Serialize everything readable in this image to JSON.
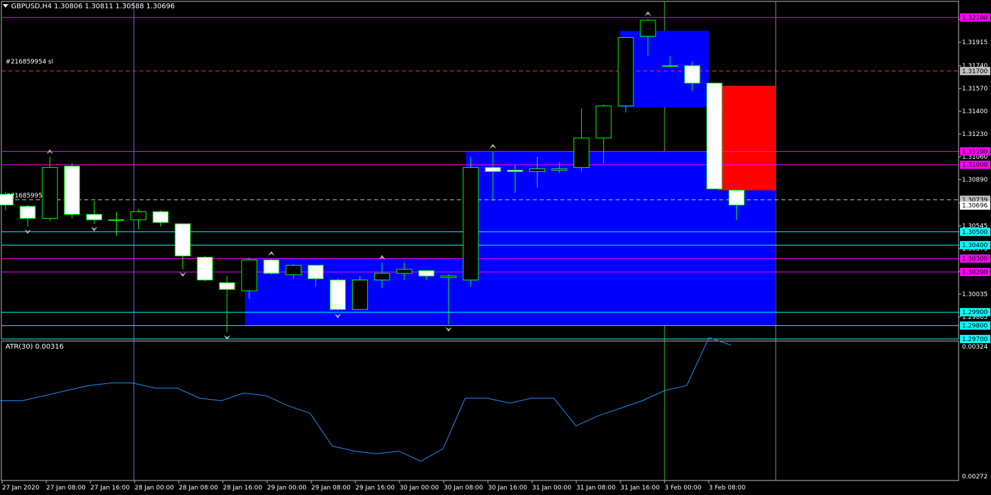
{
  "header": {
    "title": "GBPUSD,H4  1.30806 1.30811 1.30588 1.30696"
  },
  "indicator": {
    "label": "ATR(30) 0.00316"
  },
  "labels": {
    "stop_loss": "#216859954 sl",
    "order": "#21685995"
  },
  "colors": {
    "background": "#000000",
    "candle_up": "#000000",
    "candle_down": "#ffffff",
    "wick": "#00ff00",
    "zone_blue": "#0000ff",
    "zone_red": "#ff0000",
    "level_magenta": "#ff00ff",
    "level_cyan": "#00ffff",
    "atr_line": "#1e90ff",
    "grid_time": "#7b68ee",
    "grid_time2": "#32cd32"
  },
  "price_axis": {
    "ticks": [
      "1.32085",
      "1.31915",
      "1.31740",
      "1.31570",
      "1.31400",
      "1.31230",
      "1.31060",
      "1.30890",
      "1.30715",
      "1.30545",
      "1.30375",
      "1.30205",
      "1.30035",
      "1.29865"
    ],
    "ylim": [
      1.297,
      1.3222
    ]
  },
  "price_labels": [
    {
      "text": "1.32100",
      "price": 1.321,
      "color": "#ff00ff"
    },
    {
      "text": "1.31700",
      "price": 1.317,
      "color": "#c0c0c0"
    },
    {
      "text": "1.31100",
      "price": 1.311,
      "color": "#ff00ff"
    },
    {
      "text": "1.31000",
      "price": 1.31,
      "color": "#ff00ff"
    },
    {
      "text": "1.30739",
      "price": 1.30739,
      "color": "#c0c0c0"
    },
    {
      "text": "1.30696",
      "price": 1.30696,
      "color": "#ffffff"
    },
    {
      "text": "1.30500",
      "price": 1.305,
      "color": "#00ffff"
    },
    {
      "text": "1.30400",
      "price": 1.304,
      "color": "#00ffff"
    },
    {
      "text": "1.30300",
      "price": 1.303,
      "color": "#ff00ff"
    },
    {
      "text": "1.30200",
      "price": 1.302,
      "color": "#ff00ff"
    },
    {
      "text": "1.29900",
      "price": 1.299,
      "color": "#00ffff"
    },
    {
      "text": "1.29800",
      "price": 1.298,
      "color": "#00ffff"
    },
    {
      "text": "1.29700",
      "price": 1.297,
      "color": "#00ffff"
    }
  ],
  "atr_axis": {
    "ticks": [
      "0.00324",
      "0.00272"
    ],
    "ylim": [
      0.00272,
      0.00324
    ]
  },
  "time_axis": [
    "27 Jan 2020",
    "27 Jan 08:00",
    "27 Jan 16:00",
    "28 Jan 00:00",
    "28 Jan 08:00",
    "28 Jan 16:00",
    "29 Jan 00:00",
    "29 Jan 08:00",
    "29 Jan 16:00",
    "30 Jan 00:00",
    "30 Jan 08:00",
    "30 Jan 16:00",
    "31 Jan 00:00",
    "31 Jan 08:00",
    "31 Jan 16:00",
    "3 Feb 00:00",
    "3 Feb 08:00"
  ],
  "chart_data": {
    "type": "candlestick",
    "symbol": "GBPUSD",
    "timeframe": "H4",
    "candles": [
      {
        "o": 1.3078,
        "h": 1.308,
        "l": 1.3066,
        "c": 1.307
      },
      {
        "o": 1.3069,
        "h": 1.307,
        "l": 1.3054,
        "c": 1.306
      },
      {
        "o": 1.306,
        "h": 1.3106,
        "l": 1.3058,
        "c": 1.3098
      },
      {
        "o": 1.3099,
        "h": 1.3101,
        "l": 1.306,
        "c": 1.3063
      },
      {
        "o": 1.3063,
        "h": 1.3073,
        "l": 1.3056,
        "c": 1.3059
      },
      {
        "o": 1.3059,
        "h": 1.3065,
        "l": 1.3047,
        "c": 1.3059
      },
      {
        "o": 1.3059,
        "h": 1.3067,
        "l": 1.3052,
        "c": 1.3065
      },
      {
        "o": 1.3065,
        "h": 1.3066,
        "l": 1.3054,
        "c": 1.3057
      },
      {
        "o": 1.3056,
        "h": 1.3056,
        "l": 1.3022,
        "c": 1.3032
      },
      {
        "o": 1.3031,
        "h": 1.3032,
        "l": 1.3013,
        "c": 1.3014
      },
      {
        "o": 1.3012,
        "h": 1.3017,
        "l": 1.2975,
        "c": 1.3007
      },
      {
        "o": 1.3006,
        "h": 1.3031,
        "l": 1.3,
        "c": 1.3029
      },
      {
        "o": 1.3029,
        "h": 1.303,
        "l": 1.3018,
        "c": 1.3019
      },
      {
        "o": 1.3018,
        "h": 1.3026,
        "l": 1.3015,
        "c": 1.3025
      },
      {
        "o": 1.3025,
        "h": 1.3025,
        "l": 1.3009,
        "c": 1.3015
      },
      {
        "o": 1.3014,
        "h": 1.3015,
        "l": 1.2991,
        "c": 1.2992
      },
      {
        "o": 1.2992,
        "h": 1.3017,
        "l": 1.2992,
        "c": 1.3014
      },
      {
        "o": 1.3014,
        "h": 1.3027,
        "l": 1.3008,
        "c": 1.3019
      },
      {
        "o": 1.3019,
        "h": 1.3027,
        "l": 1.3014,
        "c": 1.3022
      },
      {
        "o": 1.3021,
        "h": 1.3021,
        "l": 1.3014,
        "c": 1.3017
      },
      {
        "o": 1.3016,
        "h": 1.3018,
        "l": 1.2981,
        "c": 1.3017
      },
      {
        "o": 1.3014,
        "h": 1.3106,
        "l": 1.3009,
        "c": 1.3098
      },
      {
        "o": 1.3098,
        "h": 1.311,
        "l": 1.3073,
        "c": 1.3095
      },
      {
        "o": 1.3096,
        "h": 1.31,
        "l": 1.3079,
        "c": 1.3095
      },
      {
        "o": 1.3095,
        "h": 1.3106,
        "l": 1.3083,
        "c": 1.3097
      },
      {
        "o": 1.3096,
        "h": 1.3102,
        "l": 1.3094,
        "c": 1.3097
      },
      {
        "o": 1.3098,
        "h": 1.3142,
        "l": 1.3095,
        "c": 1.312
      },
      {
        "o": 1.312,
        "h": 1.3145,
        "l": 1.3101,
        "c": 1.3144
      },
      {
        "o": 1.3144,
        "h": 1.3195,
        "l": 1.3139,
        "c": 1.3195
      },
      {
        "o": 1.3196,
        "h": 1.3209,
        "l": 1.3181,
        "c": 1.3208
      },
      {
        "o": 1.3174,
        "h": 1.3181,
        "l": 1.3173,
        "c": 1.3174
      },
      {
        "o": 1.3174,
        "h": 1.3177,
        "l": 1.3155,
        "c": 1.3161
      },
      {
        "o": 1.3161,
        "h": 1.3161,
        "l": 1.3082,
        "c": 1.3082
      },
      {
        "o": 1.3081,
        "h": 1.3081,
        "l": 1.3059,
        "c": 1.307
      }
    ],
    "atr": [
      0.00302,
      0.00302,
      0.00304,
      0.00306,
      0.00308,
      0.00309,
      0.00309,
      0.00307,
      0.00307,
      0.00303,
      0.00302,
      0.00305,
      0.00304,
      0.003,
      0.00297,
      0.00284,
      0.00282,
      0.00281,
      0.00282,
      0.00278,
      0.00283,
      0.00303,
      0.00303,
      0.00301,
      0.00303,
      0.00303,
      0.00292,
      0.00296,
      0.00299,
      0.00302,
      0.00306,
      0.00308,
      0.00327,
      0.00324
    ],
    "zones": [
      {
        "price_top": 1.32,
        "price_bottom": 1.3143,
        "color": "#0000ff"
      },
      {
        "price_top": 1.311,
        "price_bottom": 1.299,
        "color": "#0000ff"
      },
      {
        "price_top": 1.3159,
        "price_bottom": 1.3081,
        "color": "#ff0000"
      }
    ],
    "levels": [
      {
        "price": 1.321,
        "color": "#ff00ff"
      },
      {
        "price": 1.311,
        "color": "#ff00ff"
      },
      {
        "price": 1.31,
        "color": "#ff00ff"
      },
      {
        "price": 1.305,
        "color": "#00ffff"
      },
      {
        "price": 1.304,
        "color": "#00ffff"
      },
      {
        "price": 1.303,
        "color": "#ff00ff"
      },
      {
        "price": 1.302,
        "color": "#ff00ff"
      },
      {
        "price": 1.299,
        "color": "#00ffff"
      },
      {
        "price": 1.298,
        "color": "#00ffff"
      },
      {
        "price": 1.297,
        "color": "#00ffff"
      }
    ],
    "dashed_levels": [
      {
        "price": 1.317,
        "color": "#ff3333"
      },
      {
        "price": 1.30739,
        "color": "#c0c0c0"
      }
    ]
  }
}
